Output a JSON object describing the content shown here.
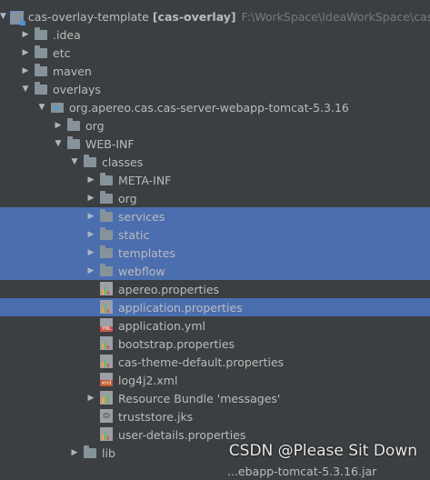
{
  "tree": {
    "root": {
      "name": "cas-overlay-template",
      "module": "[cas-overlay]",
      "path": "F:\\WorkSpace\\IdeaWorkSpace\\cas-ov"
    },
    "items": [
      {
        "label": "cas-overlay-template",
        "depth": 0,
        "arrow": "open",
        "icon": "module"
      },
      {
        "label": ".idea",
        "depth": 1,
        "arrow": "closed",
        "icon": "folder"
      },
      {
        "label": "etc",
        "depth": 1,
        "arrow": "closed",
        "icon": "folder"
      },
      {
        "label": "maven",
        "depth": 1,
        "arrow": "closed",
        "icon": "folder"
      },
      {
        "label": "overlays",
        "depth": 1,
        "arrow": "open",
        "icon": "folder"
      },
      {
        "label": "org.apereo.cas.cas-server-webapp-tomcat-5.3.16",
        "depth": 2,
        "arrow": "open",
        "icon": "pkgfolder"
      },
      {
        "label": "org",
        "depth": 3,
        "arrow": "closed",
        "icon": "folder"
      },
      {
        "label": "WEB-INF",
        "depth": 3,
        "arrow": "open",
        "icon": "folder"
      },
      {
        "label": "classes",
        "depth": 4,
        "arrow": "open",
        "icon": "folder"
      },
      {
        "label": "META-INF",
        "depth": 5,
        "arrow": "closed",
        "icon": "folder"
      },
      {
        "label": "org",
        "depth": 5,
        "arrow": "closed",
        "icon": "folder"
      },
      {
        "label": "services",
        "depth": 5,
        "arrow": "closed",
        "icon": "folder",
        "selected": true
      },
      {
        "label": "static",
        "depth": 5,
        "arrow": "closed",
        "icon": "folder",
        "selected": true
      },
      {
        "label": "templates",
        "depth": 5,
        "arrow": "closed",
        "icon": "folder",
        "selected": true
      },
      {
        "label": "webflow",
        "depth": 5,
        "arrow": "closed",
        "icon": "folder",
        "selected": true
      },
      {
        "label": "apereo.properties",
        "depth": 5,
        "arrow": "none",
        "icon": "props"
      },
      {
        "label": "application.properties",
        "depth": 5,
        "arrow": "none",
        "icon": "props",
        "selected": true
      },
      {
        "label": "application.yml",
        "depth": 5,
        "arrow": "none",
        "icon": "yml"
      },
      {
        "label": "bootstrap.properties",
        "depth": 5,
        "arrow": "none",
        "icon": "props"
      },
      {
        "label": "cas-theme-default.properties",
        "depth": 5,
        "arrow": "none",
        "icon": "props"
      },
      {
        "label": "log4j2.xml",
        "depth": 5,
        "arrow": "none",
        "icon": "xml"
      },
      {
        "label": "Resource Bundle 'messages'",
        "depth": 5,
        "arrow": "closed",
        "icon": "bundle"
      },
      {
        "label": "truststore.jks",
        "depth": 5,
        "arrow": "none",
        "icon": "jks"
      },
      {
        "label": "user-details.properties",
        "depth": 5,
        "arrow": "none",
        "icon": "props"
      },
      {
        "label": "lib",
        "depth": 4,
        "arrow": "closed",
        "icon": "folder"
      }
    ],
    "partial_label": "...ebapp-tomcat-5.3.16.jar"
  },
  "watermark": "CSDN @Please Sit Down",
  "colors": {
    "background": "#3c3f41",
    "selection": "#4b6eaf",
    "text": "#bbbbbb"
  }
}
